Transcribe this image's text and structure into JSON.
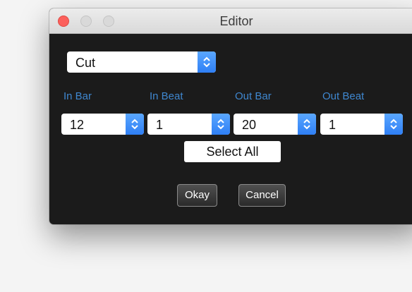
{
  "window": {
    "title": "Editor"
  },
  "mode_select": {
    "value": "Cut"
  },
  "fields": [
    {
      "label": "In Bar",
      "value": "12"
    },
    {
      "label": "In Beat",
      "value": "1"
    },
    {
      "label": "Out Bar",
      "value": "20"
    },
    {
      "label": "Out Beat",
      "value": "1"
    }
  ],
  "buttons": {
    "select_all": "Select All",
    "okay": "Okay",
    "cancel": "Cancel"
  },
  "colors": {
    "accent": "#3f87cf",
    "stepper": "#2f7ff5",
    "panel": "#1b1b1b",
    "close_button": "#fc605c"
  },
  "icons": {
    "stepper": "updown-chevron-icon"
  }
}
